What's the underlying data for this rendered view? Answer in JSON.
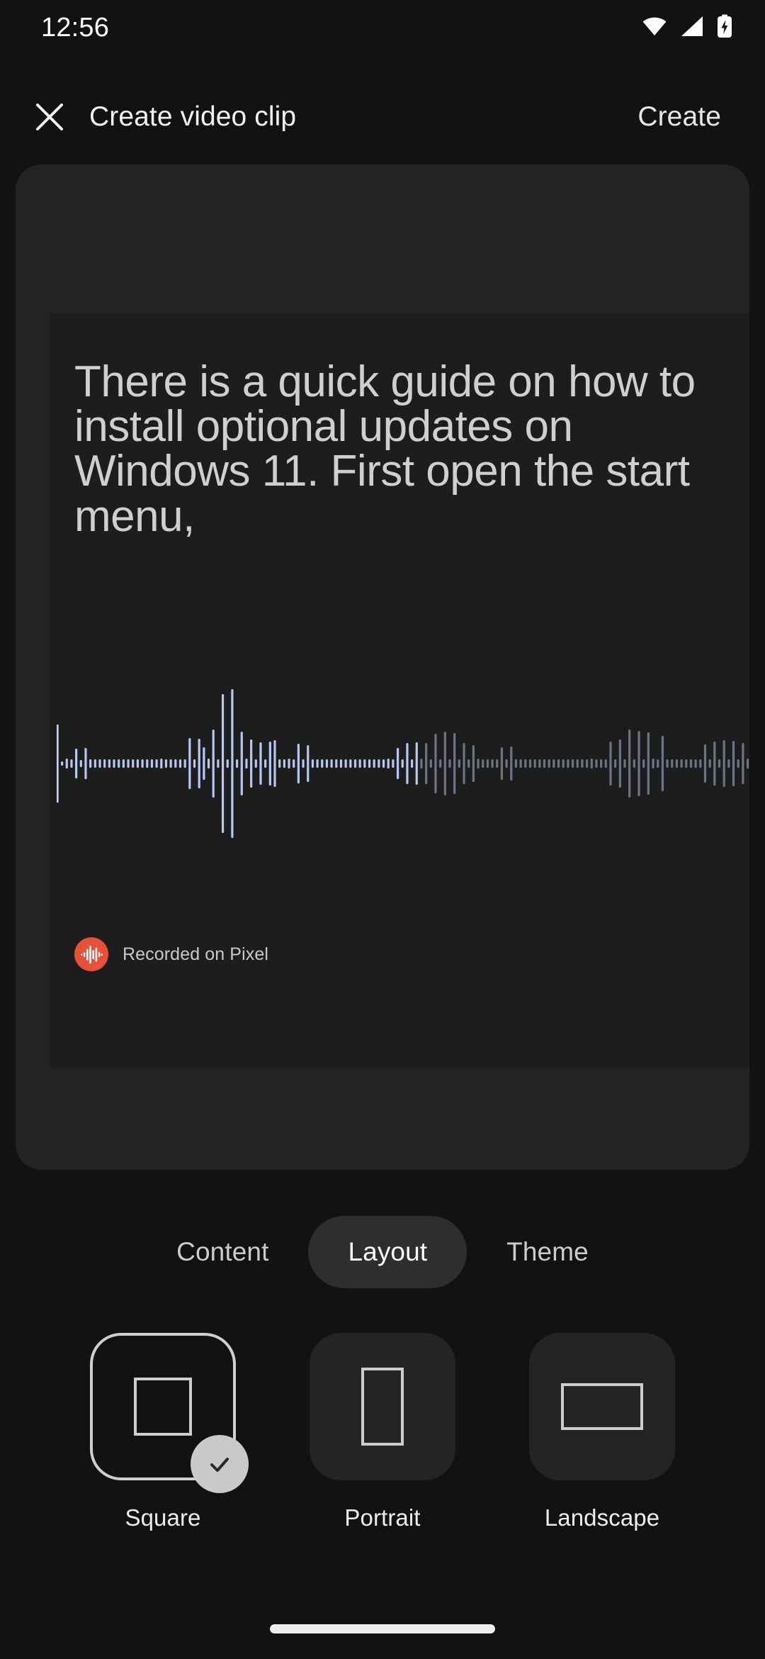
{
  "status_bar": {
    "time": "12:56",
    "icons": [
      {
        "name": "wifi-icon",
        "label": "wifi"
      },
      {
        "name": "cellular-signal-icon",
        "label": "signal"
      },
      {
        "name": "battery-charging-icon",
        "label": "battery charging"
      }
    ]
  },
  "app_bar": {
    "close_icon": "close-icon",
    "title": "Create video clip",
    "create_label": "Create"
  },
  "preview": {
    "transcript": "There is a quick guide on how to install optional updates on Windows 11. First open the start menu,",
    "recorder_badge": {
      "icon": "recorder-waveform-icon",
      "label": "Recorded on Pixel",
      "icon_color": "#e8503a"
    },
    "waveform": {
      "played_color": "#b6c8ee",
      "unplayed_color": "#6d7585",
      "playhead_color": "#c9d4ef",
      "played_fraction": 0.52,
      "bars": [
        6,
        14,
        12,
        42,
        10,
        44,
        12,
        12,
        12,
        12,
        12,
        12,
        12,
        12,
        12,
        12,
        12,
        12,
        12,
        12,
        12,
        14,
        12,
        12,
        12,
        12,
        12,
        72,
        12,
        70,
        46,
        14,
        96,
        12,
        196,
        12,
        210,
        12,
        90,
        14,
        68,
        12,
        60,
        12,
        62,
        66,
        12,
        12,
        14,
        12,
        56,
        12,
        52,
        12,
        12,
        12,
        12,
        12,
        12,
        12,
        12,
        12,
        12,
        12,
        12,
        12,
        12,
        12,
        12,
        14,
        12,
        44,
        12,
        58,
        12,
        60,
        14,
        58,
        12,
        84,
        12,
        90,
        12,
        86,
        12,
        58,
        12,
        52,
        14,
        12,
        12,
        12,
        12,
        46,
        12,
        48,
        12,
        12,
        12,
        12,
        12,
        12,
        12,
        12,
        12,
        12,
        12,
        12,
        12,
        12,
        12,
        12,
        14,
        12,
        12,
        12,
        62,
        12,
        68,
        12,
        96,
        12,
        92,
        12,
        88,
        14,
        12,
        78,
        12,
        12,
        12,
        12,
        12,
        12,
        12,
        12,
        54,
        12,
        62,
        12,
        66,
        12,
        64,
        12,
        58,
        14,
        12,
        12
      ]
    }
  },
  "tabs": [
    {
      "label": "Content",
      "active": false
    },
    {
      "label": "Layout",
      "active": true
    },
    {
      "label": "Theme",
      "active": false
    }
  ],
  "layout_options": [
    {
      "label": "Square",
      "shape": "square",
      "selected": true
    },
    {
      "label": "Portrait",
      "shape": "portrait",
      "selected": false
    },
    {
      "label": "Landscape",
      "shape": "landscape",
      "selected": false
    }
  ],
  "colors": {
    "background": "#121212",
    "card": "#232323",
    "card_inner": "#1d1d1d",
    "accent_recorder": "#e8503a",
    "check_badge": "#c9c9c9"
  }
}
